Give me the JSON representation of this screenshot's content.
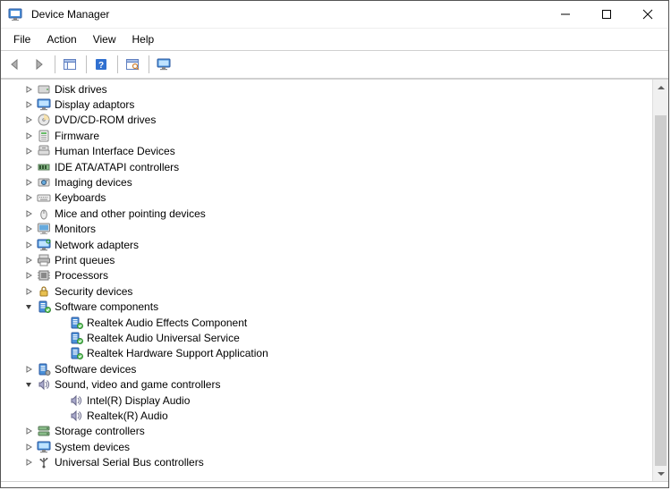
{
  "window": {
    "title": "Device Manager"
  },
  "menu": {
    "file": "File",
    "action": "Action",
    "view": "View",
    "help": "Help"
  },
  "tree": [
    {
      "id": "disk-drives",
      "label": "Disk drives",
      "icon": "disk",
      "state": "closed",
      "level": 1
    },
    {
      "id": "display-adaptors",
      "label": "Display adaptors",
      "icon": "display",
      "state": "closed",
      "level": 1
    },
    {
      "id": "dvd-cdrom",
      "label": "DVD/CD-ROM drives",
      "icon": "cdrom",
      "state": "closed",
      "level": 1
    },
    {
      "id": "firmware",
      "label": "Firmware",
      "icon": "firmware",
      "state": "closed",
      "level": 1
    },
    {
      "id": "hid",
      "label": "Human Interface Devices",
      "icon": "hid",
      "state": "closed",
      "level": 1
    },
    {
      "id": "ide",
      "label": "IDE ATA/ATAPI controllers",
      "icon": "ide",
      "state": "closed",
      "level": 1
    },
    {
      "id": "imaging",
      "label": "Imaging devices",
      "icon": "imaging",
      "state": "closed",
      "level": 1
    },
    {
      "id": "keyboards",
      "label": "Keyboards",
      "icon": "keyboard",
      "state": "closed",
      "level": 1
    },
    {
      "id": "mice",
      "label": "Mice and other pointing devices",
      "icon": "mouse",
      "state": "closed",
      "level": 1
    },
    {
      "id": "monitors",
      "label": "Monitors",
      "icon": "monitor",
      "state": "closed",
      "level": 1
    },
    {
      "id": "network",
      "label": "Network adapters",
      "icon": "network",
      "state": "closed",
      "level": 1
    },
    {
      "id": "printq",
      "label": "Print queues",
      "icon": "printer",
      "state": "closed",
      "level": 1
    },
    {
      "id": "processors",
      "label": "Processors",
      "icon": "cpu",
      "state": "closed",
      "level": 1
    },
    {
      "id": "security",
      "label": "Security devices",
      "icon": "security",
      "state": "closed",
      "level": 1
    },
    {
      "id": "software-components",
      "label": "Software components",
      "icon": "swcomp",
      "state": "open",
      "level": 1
    },
    {
      "id": "realtek-audio-effects",
      "label": "Realtek Audio Effects Component",
      "icon": "swcomp",
      "state": "none",
      "level": 2
    },
    {
      "id": "realtek-audio-universal",
      "label": "Realtek Audio Universal Service",
      "icon": "swcomp",
      "state": "none",
      "level": 2
    },
    {
      "id": "realtek-hw-support",
      "label": "Realtek Hardware Support Application",
      "icon": "swcomp",
      "state": "none",
      "level": 2
    },
    {
      "id": "software-devices",
      "label": "Software devices",
      "icon": "swdev",
      "state": "closed",
      "level": 1
    },
    {
      "id": "sound",
      "label": "Sound, video and game controllers",
      "icon": "audio",
      "state": "open",
      "level": 1
    },
    {
      "id": "intel-display-audio",
      "label": "Intel(R) Display Audio",
      "icon": "audio",
      "state": "none",
      "level": 2
    },
    {
      "id": "realtek-audio",
      "label": "Realtek(R) Audio",
      "icon": "audio",
      "state": "none",
      "level": 2
    },
    {
      "id": "storage-controllers",
      "label": "Storage controllers",
      "icon": "storage",
      "state": "closed",
      "level": 1
    },
    {
      "id": "system-devices",
      "label": "System devices",
      "icon": "system",
      "state": "closed",
      "level": 1
    },
    {
      "id": "usb",
      "label": "Universal Serial Bus controllers",
      "icon": "usb",
      "state": "closed",
      "level": 1
    }
  ]
}
